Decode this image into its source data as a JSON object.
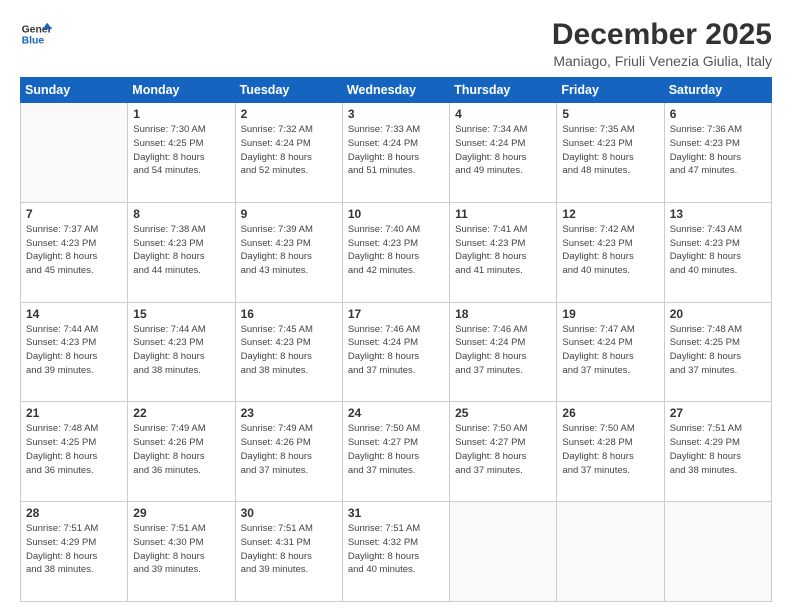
{
  "logo": {
    "line1": "General",
    "line2": "Blue"
  },
  "title": "December 2025",
  "location": "Maniago, Friuli Venezia Giulia, Italy",
  "weekdays": [
    "Sunday",
    "Monday",
    "Tuesday",
    "Wednesday",
    "Thursday",
    "Friday",
    "Saturday"
  ],
  "weeks": [
    [
      {
        "day": "",
        "info": ""
      },
      {
        "day": "1",
        "info": "Sunrise: 7:30 AM\nSunset: 4:25 PM\nDaylight: 8 hours\nand 54 minutes."
      },
      {
        "day": "2",
        "info": "Sunrise: 7:32 AM\nSunset: 4:24 PM\nDaylight: 8 hours\nand 52 minutes."
      },
      {
        "day": "3",
        "info": "Sunrise: 7:33 AM\nSunset: 4:24 PM\nDaylight: 8 hours\nand 51 minutes."
      },
      {
        "day": "4",
        "info": "Sunrise: 7:34 AM\nSunset: 4:24 PM\nDaylight: 8 hours\nand 49 minutes."
      },
      {
        "day": "5",
        "info": "Sunrise: 7:35 AM\nSunset: 4:23 PM\nDaylight: 8 hours\nand 48 minutes."
      },
      {
        "day": "6",
        "info": "Sunrise: 7:36 AM\nSunset: 4:23 PM\nDaylight: 8 hours\nand 47 minutes."
      }
    ],
    [
      {
        "day": "7",
        "info": "Sunrise: 7:37 AM\nSunset: 4:23 PM\nDaylight: 8 hours\nand 45 minutes."
      },
      {
        "day": "8",
        "info": "Sunrise: 7:38 AM\nSunset: 4:23 PM\nDaylight: 8 hours\nand 44 minutes."
      },
      {
        "day": "9",
        "info": "Sunrise: 7:39 AM\nSunset: 4:23 PM\nDaylight: 8 hours\nand 43 minutes."
      },
      {
        "day": "10",
        "info": "Sunrise: 7:40 AM\nSunset: 4:23 PM\nDaylight: 8 hours\nand 42 minutes."
      },
      {
        "day": "11",
        "info": "Sunrise: 7:41 AM\nSunset: 4:23 PM\nDaylight: 8 hours\nand 41 minutes."
      },
      {
        "day": "12",
        "info": "Sunrise: 7:42 AM\nSunset: 4:23 PM\nDaylight: 8 hours\nand 40 minutes."
      },
      {
        "day": "13",
        "info": "Sunrise: 7:43 AM\nSunset: 4:23 PM\nDaylight: 8 hours\nand 40 minutes."
      }
    ],
    [
      {
        "day": "14",
        "info": "Sunrise: 7:44 AM\nSunset: 4:23 PM\nDaylight: 8 hours\nand 39 minutes."
      },
      {
        "day": "15",
        "info": "Sunrise: 7:44 AM\nSunset: 4:23 PM\nDaylight: 8 hours\nand 38 minutes."
      },
      {
        "day": "16",
        "info": "Sunrise: 7:45 AM\nSunset: 4:23 PM\nDaylight: 8 hours\nand 38 minutes."
      },
      {
        "day": "17",
        "info": "Sunrise: 7:46 AM\nSunset: 4:24 PM\nDaylight: 8 hours\nand 37 minutes."
      },
      {
        "day": "18",
        "info": "Sunrise: 7:46 AM\nSunset: 4:24 PM\nDaylight: 8 hours\nand 37 minutes."
      },
      {
        "day": "19",
        "info": "Sunrise: 7:47 AM\nSunset: 4:24 PM\nDaylight: 8 hours\nand 37 minutes."
      },
      {
        "day": "20",
        "info": "Sunrise: 7:48 AM\nSunset: 4:25 PM\nDaylight: 8 hours\nand 37 minutes."
      }
    ],
    [
      {
        "day": "21",
        "info": "Sunrise: 7:48 AM\nSunset: 4:25 PM\nDaylight: 8 hours\nand 36 minutes."
      },
      {
        "day": "22",
        "info": "Sunrise: 7:49 AM\nSunset: 4:26 PM\nDaylight: 8 hours\nand 36 minutes."
      },
      {
        "day": "23",
        "info": "Sunrise: 7:49 AM\nSunset: 4:26 PM\nDaylight: 8 hours\nand 37 minutes."
      },
      {
        "day": "24",
        "info": "Sunrise: 7:50 AM\nSunset: 4:27 PM\nDaylight: 8 hours\nand 37 minutes."
      },
      {
        "day": "25",
        "info": "Sunrise: 7:50 AM\nSunset: 4:27 PM\nDaylight: 8 hours\nand 37 minutes."
      },
      {
        "day": "26",
        "info": "Sunrise: 7:50 AM\nSunset: 4:28 PM\nDaylight: 8 hours\nand 37 minutes."
      },
      {
        "day": "27",
        "info": "Sunrise: 7:51 AM\nSunset: 4:29 PM\nDaylight: 8 hours\nand 38 minutes."
      }
    ],
    [
      {
        "day": "28",
        "info": "Sunrise: 7:51 AM\nSunset: 4:29 PM\nDaylight: 8 hours\nand 38 minutes."
      },
      {
        "day": "29",
        "info": "Sunrise: 7:51 AM\nSunset: 4:30 PM\nDaylight: 8 hours\nand 39 minutes."
      },
      {
        "day": "30",
        "info": "Sunrise: 7:51 AM\nSunset: 4:31 PM\nDaylight: 8 hours\nand 39 minutes."
      },
      {
        "day": "31",
        "info": "Sunrise: 7:51 AM\nSunset: 4:32 PM\nDaylight: 8 hours\nand 40 minutes."
      },
      {
        "day": "",
        "info": ""
      },
      {
        "day": "",
        "info": ""
      },
      {
        "day": "",
        "info": ""
      }
    ]
  ]
}
